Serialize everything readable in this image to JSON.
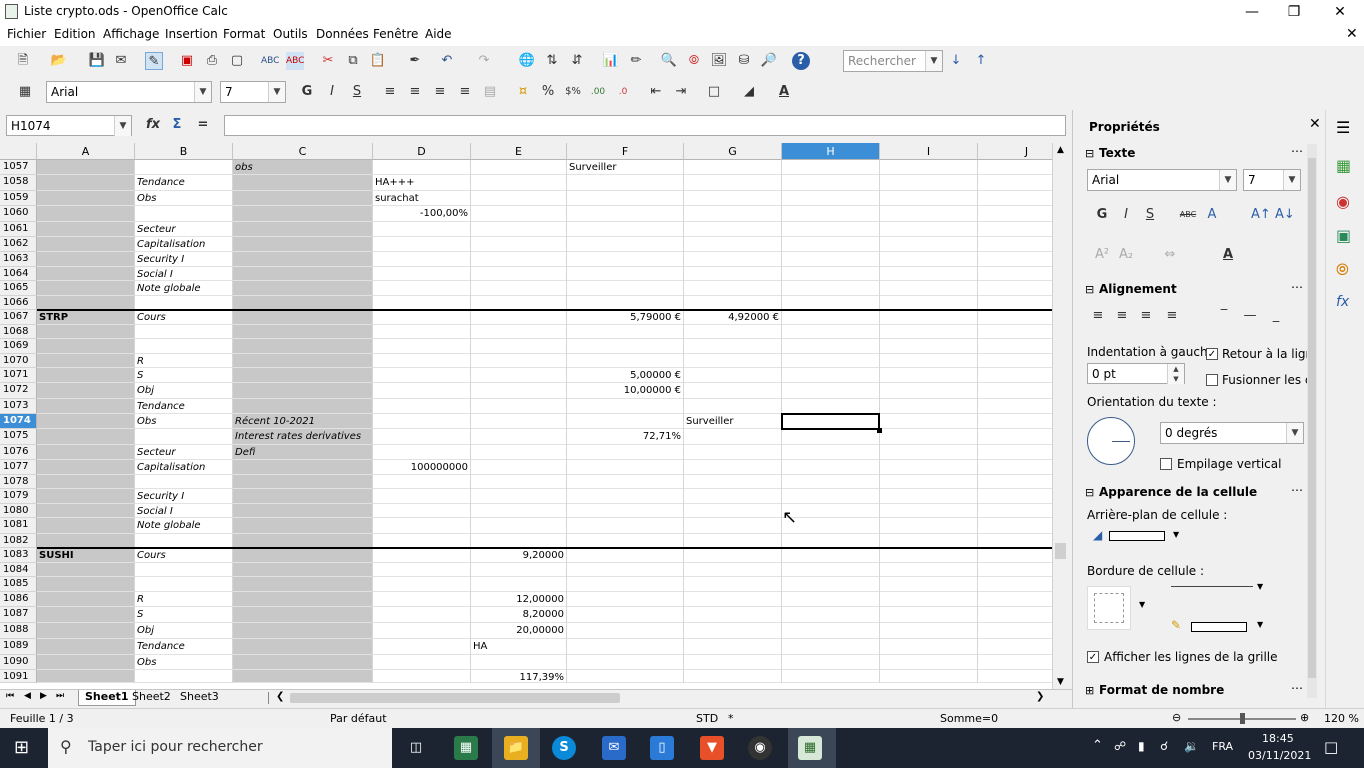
{
  "window": {
    "title": "Liste crypto.ods - OpenOffice Calc"
  },
  "menu": [
    "Fichier",
    "Edition",
    "Affichage",
    "Insertion",
    "Format",
    "Outils",
    "Données",
    "Fenêtre",
    "Aide"
  ],
  "search": {
    "placeholder": "Rechercher"
  },
  "font": {
    "name": "Arial",
    "size": "7"
  },
  "namebox": "H1074",
  "columns": [
    "A",
    "B",
    "C",
    "D",
    "E",
    "F",
    "G",
    "H",
    "I",
    "J"
  ],
  "selected_column": "H",
  "rows": [
    {
      "n": "1057",
      "c": {
        "C": "obs",
        "F": "Surveiller"
      }
    },
    {
      "n": "1058",
      "c": {
        "B": "Tendance",
        "D": "HA+++"
      }
    },
    {
      "n": "1059",
      "c": {
        "B": "Obs",
        "D": "surachat"
      }
    },
    {
      "n": "1060",
      "c": {
        "D": "-100,00%"
      }
    },
    {
      "n": "1061",
      "c": {
        "B": "Secteur"
      }
    },
    {
      "n": "1062",
      "c": {
        "B": "Capitalisation"
      }
    },
    {
      "n": "1063",
      "c": {
        "B": "Security I"
      }
    },
    {
      "n": "1064",
      "c": {
        "B": "Social I"
      }
    },
    {
      "n": "1065",
      "c": {
        "B": "Note globale"
      }
    },
    {
      "n": "1066",
      "c": {}
    },
    {
      "n": "1067",
      "c": {
        "A": "STRP",
        "B": "Cours",
        "F": "5,79000 €",
        "G": "4,92000 €"
      }
    },
    {
      "n": "1068",
      "c": {}
    },
    {
      "n": "1069",
      "c": {}
    },
    {
      "n": "1070",
      "c": {
        "B": "R"
      }
    },
    {
      "n": "1071",
      "c": {
        "B": "S",
        "F": "5,00000 €"
      }
    },
    {
      "n": "1072",
      "c": {
        "B": "Obj",
        "F": "10,00000 €"
      }
    },
    {
      "n": "1073",
      "c": {
        "B": "Tendance"
      }
    },
    {
      "n": "1074",
      "c": {
        "B": "Obs",
        "C": "Récent 10-2021",
        "G": "Surveiller"
      }
    },
    {
      "n": "1075",
      "c": {
        "C": "Interest rates derivatives",
        "F": "72,71%"
      }
    },
    {
      "n": "1076",
      "c": {
        "B": "Secteur",
        "C": "Defi"
      }
    },
    {
      "n": "1077",
      "c": {
        "B": "Capitalisation",
        "D": "100000000"
      }
    },
    {
      "n": "1078",
      "c": {}
    },
    {
      "n": "1079",
      "c": {
        "B": "Security I"
      }
    },
    {
      "n": "1080",
      "c": {
        "B": "Social I"
      }
    },
    {
      "n": "1081",
      "c": {
        "B": "Note globale"
      }
    },
    {
      "n": "1082",
      "c": {}
    },
    {
      "n": "1083",
      "c": {
        "A": "SUSHI",
        "B": "Cours",
        "E": "9,20000"
      }
    },
    {
      "n": "1084",
      "c": {}
    },
    {
      "n": "1085",
      "c": {}
    },
    {
      "n": "1086",
      "c": {
        "B": "R",
        "E": "12,00000"
      }
    },
    {
      "n": "1087",
      "c": {
        "B": "S",
        "E": "8,20000"
      }
    },
    {
      "n": "1088",
      "c": {
        "B": "Obj",
        "E": "20,00000"
      }
    },
    {
      "n": "1089",
      "c": {
        "B": "Tendance",
        "E": "HA"
      }
    },
    {
      "n": "1090",
      "c": {
        "B": "Obs"
      }
    },
    {
      "n": "1091",
      "c": {
        "E": "117,39%"
      }
    }
  ],
  "selected_row": "1074",
  "sheets": [
    "Sheet1",
    "Sheet2",
    "Sheet3"
  ],
  "active_sheet": "Sheet1",
  "status": {
    "sheet": "Feuille 1 / 3",
    "style": "Par défaut",
    "mode": "STD",
    "modified": "*",
    "sum": "Somme=0",
    "zoom": "120 %"
  },
  "sidebar": {
    "title": "Propriétés",
    "texte": "Texte",
    "font": "Arial",
    "size": "7",
    "alignement": "Alignement",
    "indent_label": "Indentation à gauche",
    "indent_value": "0 pt",
    "wrap": "Retour à la ligne",
    "merge": "Fusionner les ce",
    "orientation_label": "Orientation du texte :",
    "orientation_value": "0 degrés",
    "stack": "Empilage vertical",
    "apparence": "Apparence de la cellule",
    "bg_label": "Arrière-plan de cellule :",
    "border_label": "Bordure de cellule :",
    "gridlines": "Afficher les lignes de la grille",
    "number_format": "Format de nombre"
  },
  "taskbar": {
    "search": "Taper ici pour rechercher",
    "lang": "FRA",
    "time": "18:45",
    "date": "03/11/2021"
  }
}
